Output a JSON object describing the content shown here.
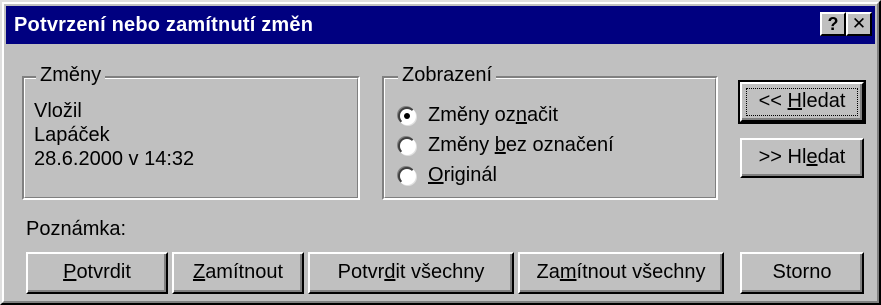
{
  "window": {
    "title": "Potvrzení nebo zamítnutí změn",
    "help_button": "?",
    "close_button": "✕"
  },
  "changes_group": {
    "legend": "Změny",
    "action": "Vložil",
    "author": "Lapáček",
    "datetime": "28.6.2000 v 14:32"
  },
  "display_group": {
    "legend": "Zobrazení",
    "options": [
      {
        "pre": "Změny oz",
        "key": "n",
        "post": "ačit",
        "selected": true
      },
      {
        "pre": "Změny ",
        "key": "b",
        "post": "ez označení",
        "selected": false
      },
      {
        "pre": "",
        "key": "O",
        "post": "riginál",
        "selected": false
      }
    ]
  },
  "find_buttons": {
    "prev": {
      "pre": "<< ",
      "key": "H",
      "post": "ledat"
    },
    "next": {
      "pre": ">> Hl",
      "key": "e",
      "post": "dat"
    }
  },
  "note_label": "Poznámka:",
  "bottom_buttons": {
    "accept": {
      "pre": "",
      "key": "P",
      "post": "otvrdit"
    },
    "reject": {
      "pre": "",
      "key": "Z",
      "post": "amítnout"
    },
    "accept_all": {
      "pre": "Potvr",
      "key": "d",
      "post": "it všechny"
    },
    "reject_all": {
      "pre": "Za",
      "key": "m",
      "post": "ítnout všechny"
    },
    "cancel": {
      "pre": "Storno",
      "key": "",
      "post": ""
    }
  }
}
